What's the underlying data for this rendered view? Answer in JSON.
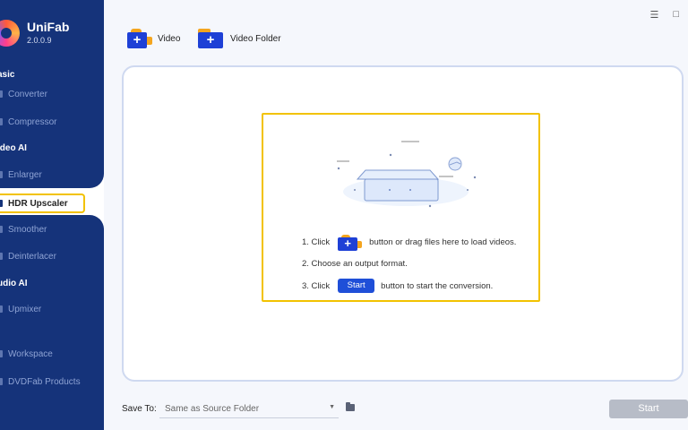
{
  "app": {
    "name": "UniFab",
    "version": "2.0.0.9"
  },
  "sidebar": {
    "sections": [
      {
        "title": "asic",
        "items": [
          "Converter",
          "Compressor"
        ]
      },
      {
        "title": "ideo AI",
        "items": [
          "Enlarger",
          "HDR Upscaler",
          "Smoother",
          "Deinterlacer"
        ]
      },
      {
        "title": "udio AI",
        "items": [
          "Upmixer"
        ]
      }
    ],
    "bottom_items": [
      "Workspace",
      "DVDFab Products"
    ],
    "active_item": "HDR Upscaler"
  },
  "toolbar": {
    "video_label": "Video",
    "video_folder_label": "Video Folder"
  },
  "window": {
    "menu_glyph": "☰",
    "maximize_glyph": "□"
  },
  "instructions": {
    "step1_before": "1. Click",
    "step1_after": "button or drag files here to load videos.",
    "step2": "2. Choose an output format.",
    "step3_before": "3. Click",
    "step3_button": "Start",
    "step3_after": "button to start the conversion."
  },
  "footer": {
    "save_to_label": "Save To:",
    "save_to_value": "Same as Source Folder",
    "start_label": "Start"
  },
  "colors": {
    "sidebar": "#15337a",
    "accent": "#1e40d6",
    "highlight": "#f2c200",
    "orange": "#f4a51f"
  }
}
